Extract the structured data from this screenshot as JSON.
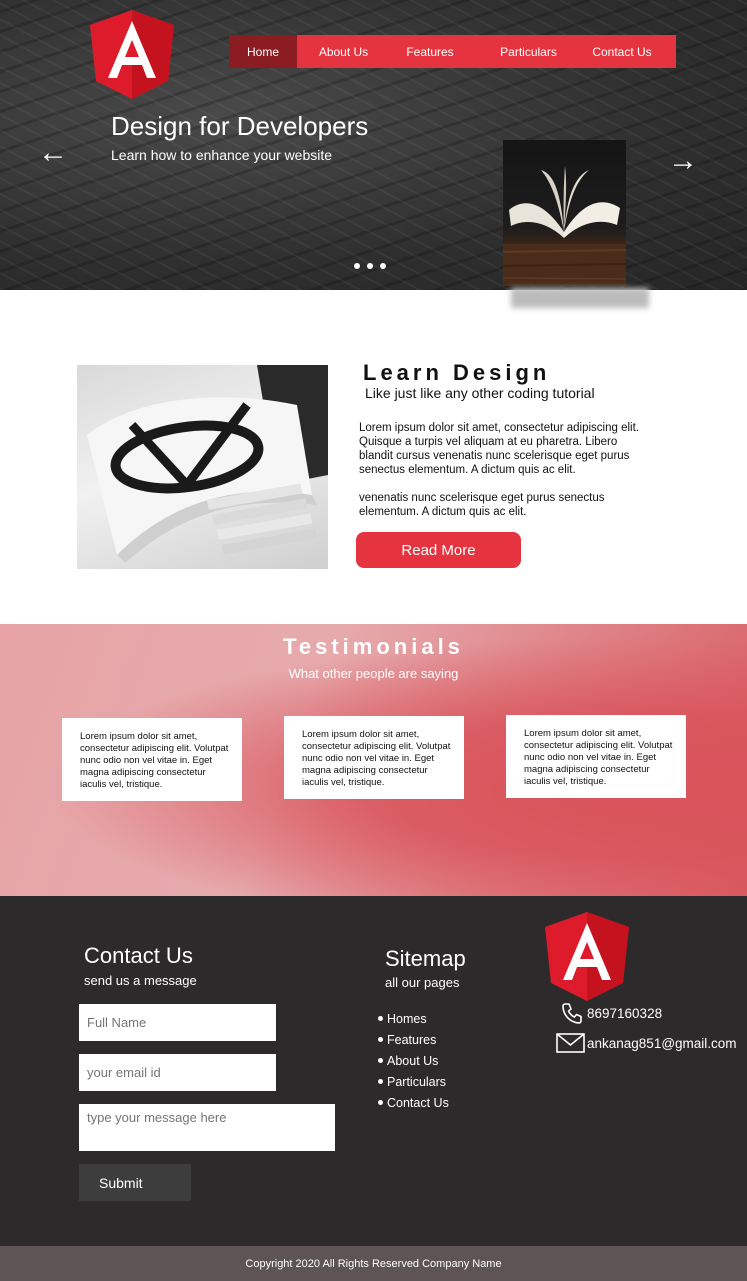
{
  "nav": {
    "items": [
      "Home",
      "About Us",
      "Features",
      "Particulars",
      "Contact Us"
    ],
    "active": "Home"
  },
  "hero": {
    "title": "Design for Developers",
    "subtitle": "Learn how to enhance your website",
    "prev_arrow": "←",
    "next_arrow": "→"
  },
  "learn": {
    "title": "Learn Design",
    "subtitle": "Like just like any other coding tutorial",
    "paragraph1": "Lorem ipsum dolor sit amet, consectetur adipiscing elit. Quisque a turpis vel aliquam at eu pharetra. Libero blandit cursus venenatis nunc scelerisque eget purus senectus elementum. A dictum quis ac elit.",
    "paragraph2": "venenatis nunc scelerisque eget purus senectus elementum. A dictum quis ac elit.",
    "button": "Read More"
  },
  "testimonials": {
    "title": "Testimonials",
    "subtitle": "What other people are saying",
    "cards": [
      "Lorem ipsum dolor sit amet, consectetur adipiscing elit. Volutpat nunc odio non vel vitae in. Eget magna adipiscing consectetur iaculis vel, tristique.",
      "Lorem ipsum dolor sit amet, consectetur adipiscing elit. Volutpat nunc odio non vel vitae in. Eget magna adipiscing consectetur iaculis vel, tristique.",
      "Lorem ipsum dolor sit amet, consectetur adipiscing elit. Volutpat nunc odio non vel vitae in. Eget magna adipiscing consectetur iaculis vel, tristique."
    ]
  },
  "contact": {
    "title": "Contact Us",
    "subtitle": "send us a message",
    "name_placeholder": "Full Name",
    "email_placeholder": "your email id",
    "message_placeholder": "type your message here",
    "submit": "Submit"
  },
  "sitemap": {
    "title": "Sitemap",
    "subtitle": "all our pages",
    "items": [
      "Homes",
      "Features",
      "About Us",
      "Particulars",
      "Contact Us"
    ]
  },
  "info": {
    "phone": "8697160328",
    "email": "ankanag851@gmail.com"
  },
  "copyright": "Copyright 2020 All Rights Reserved Company Name",
  "colors": {
    "brand_red": "#e5333f",
    "nav_active": "#8a1c22",
    "footer_bg": "#2c2a2a",
    "copyright_bg": "#5d5453"
  },
  "icons": [
    "angular-logo-icon",
    "arrow-left-icon",
    "arrow-right-icon",
    "phone-icon",
    "mail-icon"
  ]
}
